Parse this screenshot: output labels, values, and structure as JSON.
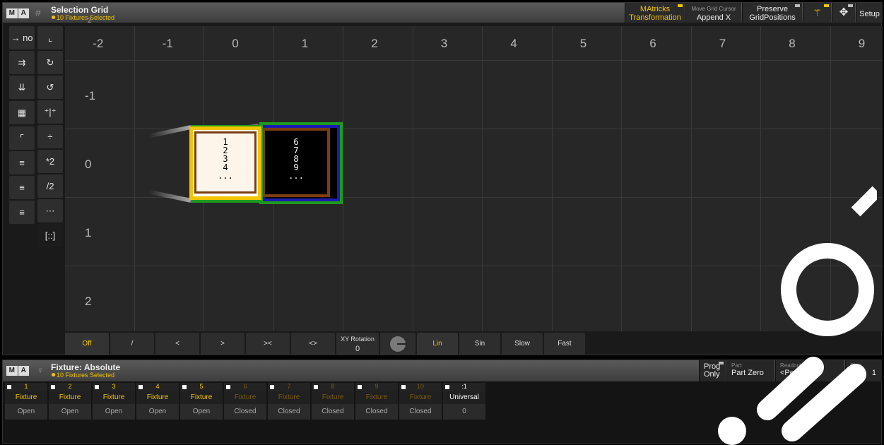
{
  "top_window": {
    "logo": [
      "M",
      "A"
    ],
    "title": "Selection Grid",
    "subtitle": "10 Fixtures Selected",
    "ghost_label": "2",
    "toolbar": {
      "matricks_l1": "MAtricks",
      "matricks_l2": "Transformation",
      "move_cursor_cap": "Move Grid Cursor",
      "move_cursor_val": "Append X",
      "preserve_l1": "Preserve",
      "preserve_l2": "GridPositions",
      "setup": "Setup"
    }
  },
  "left_tools": {
    "col1": [
      "→ no",
      "⇉",
      "⇊",
      "▦",
      "⌜",
      "≡",
      "≡",
      "≡"
    ],
    "col2": [
      "⌞",
      "↻",
      "↺",
      "⁺|⁺",
      "÷",
      "*2",
      "/2",
      "⋯",
      "[::]"
    ]
  },
  "grid": {
    "x_labels": [
      "-2",
      "-1",
      "0",
      "1",
      "2",
      "3",
      "4",
      "5",
      "6",
      "7",
      "8",
      "9"
    ],
    "y_labels": [
      "-1",
      "0",
      "1",
      "2"
    ],
    "fixture_block_a": [
      "1",
      "2",
      "3",
      "4",
      "..."
    ],
    "fixture_block_b": [
      "6",
      "7",
      "8",
      "9",
      "..."
    ]
  },
  "bottom_bar": {
    "buttons": [
      "Off",
      "/",
      "<",
      ">",
      "><",
      "<>"
    ],
    "xy_caption": "XY Rotation",
    "xy_value": "0",
    "interp": [
      "Lin",
      "Sin",
      "Slow",
      "Fast"
    ]
  },
  "lower_window": {
    "logo": [
      "M",
      "A"
    ],
    "title": "Fixture: Absolute",
    "subtitle": "10 Fixtures Selected",
    "prog_l1": "Prog",
    "prog_l2": "Only",
    "part_cap": "Part",
    "part_val": "Part Zero",
    "readout_cap": "Readout",
    "readout_val": "<Percent>",
    "step_cap": "Step",
    "step_val": "1"
  },
  "fixtures": [
    {
      "id": "1",
      "type": "Fixture",
      "state": "Open"
    },
    {
      "id": "2",
      "type": "Fixture",
      "state": "Open"
    },
    {
      "id": "3",
      "type": "Fixture",
      "state": "Open"
    },
    {
      "id": "4",
      "type": "Fixture",
      "state": "Open"
    },
    {
      "id": "5",
      "type": "Fixture",
      "state": "Open"
    },
    {
      "id": "6",
      "type": "Fixture",
      "state": "Closed"
    },
    {
      "id": "7",
      "type": "Fixture",
      "state": "Closed"
    },
    {
      "id": "8",
      "type": "Fixture",
      "state": "Closed"
    },
    {
      "id": "9",
      "type": "Fixture",
      "state": "Closed"
    },
    {
      "id": "10",
      "type": "Fixture",
      "state": "Closed"
    },
    {
      "id": ":1",
      "type": "Universal",
      "state": "0"
    }
  ],
  "colors": {
    "accent": "#f3c400",
    "grid_bg": "#272727"
  }
}
